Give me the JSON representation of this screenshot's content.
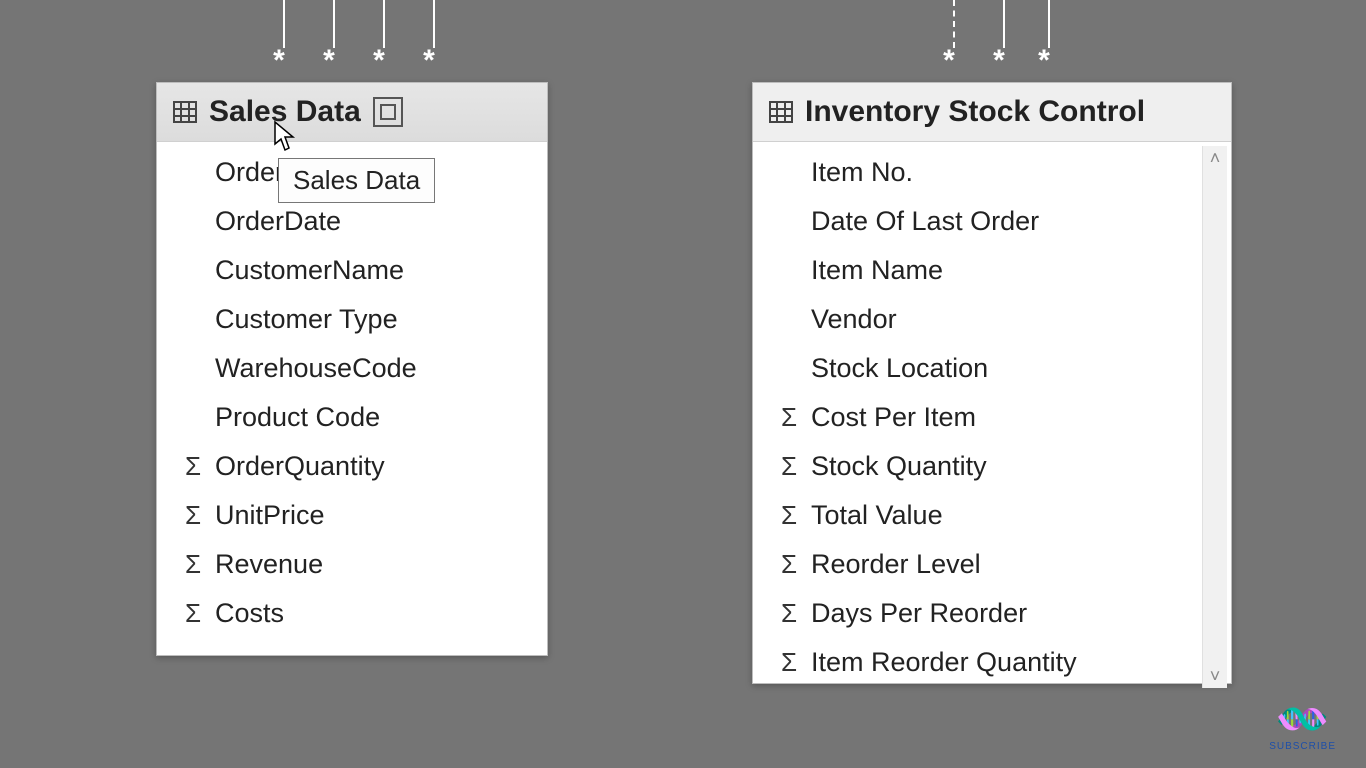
{
  "tables": {
    "sales": {
      "title": "Sales Data",
      "tooltip": "Sales Data",
      "fields": [
        {
          "name": "Order",
          "numeric": false
        },
        {
          "name": "OrderDate",
          "numeric": false
        },
        {
          "name": "CustomerName",
          "numeric": false
        },
        {
          "name": "Customer Type",
          "numeric": false
        },
        {
          "name": "WarehouseCode",
          "numeric": false
        },
        {
          "name": "Product Code",
          "numeric": false
        },
        {
          "name": "OrderQuantity",
          "numeric": true
        },
        {
          "name": "UnitPrice",
          "numeric": true
        },
        {
          "name": "Revenue",
          "numeric": true
        },
        {
          "name": "Costs",
          "numeric": true
        }
      ]
    },
    "inventory": {
      "title": "Inventory Stock Control",
      "fields": [
        {
          "name": "Item No.",
          "numeric": false
        },
        {
          "name": "Date Of Last Order",
          "numeric": false
        },
        {
          "name": "Item Name",
          "numeric": false
        },
        {
          "name": "Vendor",
          "numeric": false
        },
        {
          "name": "Stock Location",
          "numeric": false
        },
        {
          "name": "Cost Per Item",
          "numeric": true
        },
        {
          "name": "Stock Quantity",
          "numeric": true
        },
        {
          "name": "Total Value",
          "numeric": true
        },
        {
          "name": "Reorder Level",
          "numeric": true
        },
        {
          "name": "Days Per Reorder",
          "numeric": true
        },
        {
          "name": "Item Reorder Quantity",
          "numeric": true
        }
      ]
    }
  },
  "connectors": {
    "sales": {
      "many_marker": "*",
      "lines": [
        {
          "dashed": false
        },
        {
          "dashed": false
        },
        {
          "dashed": false
        },
        {
          "dashed": false
        }
      ]
    },
    "inventory": {
      "many_marker": "*",
      "lines": [
        {
          "dashed": true
        },
        {
          "dashed": false
        },
        {
          "dashed": false
        }
      ]
    }
  },
  "watermark": {
    "label": "SUBSCRIBE"
  }
}
